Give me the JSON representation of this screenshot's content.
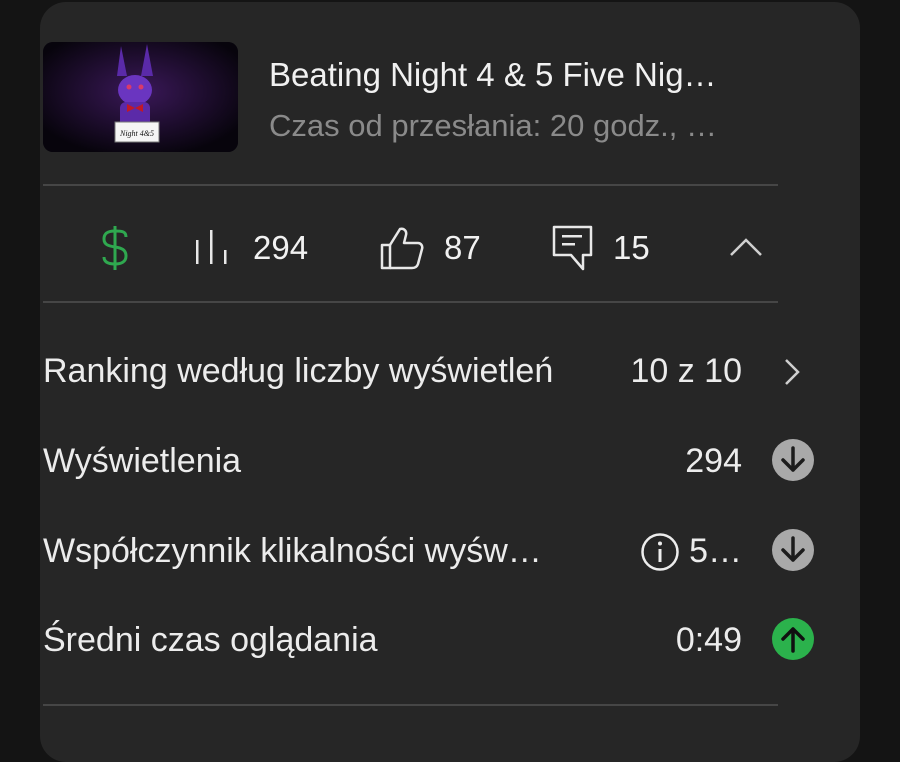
{
  "video": {
    "title": "Beating Night 4 & 5   Five Nig…",
    "subtitle": "Czas od przesłania: 20 godz., …",
    "thumbnail_text": "Night 4&5"
  },
  "stats": {
    "views": "294",
    "likes": "87",
    "comments": "15",
    "icons": [
      "dollar-icon",
      "bar-chart-icon",
      "thumbs-up-icon",
      "comment-icon",
      "chevron-up-icon"
    ]
  },
  "metrics": [
    {
      "label": "Ranking według liczby wyświetleń",
      "value": "10 z 10",
      "indicator": "chevron-right-icon"
    },
    {
      "label": "Wyświetlenia",
      "value": "294",
      "indicator": "arrow-down-icon"
    },
    {
      "label": "Współczynnik klikalności wyśw…",
      "value": "5…",
      "indicator": "arrow-down-icon"
    },
    {
      "label": "Średni czas oglądania",
      "value": "0:49",
      "indicator": "arrow-up-icon"
    }
  ],
  "colors": {
    "monetization_green": "#2fa84f",
    "up_green": "#2bb24c",
    "down_gray": "#a9a9a9",
    "card_bg": "#262626",
    "page_bg": "#141414"
  }
}
